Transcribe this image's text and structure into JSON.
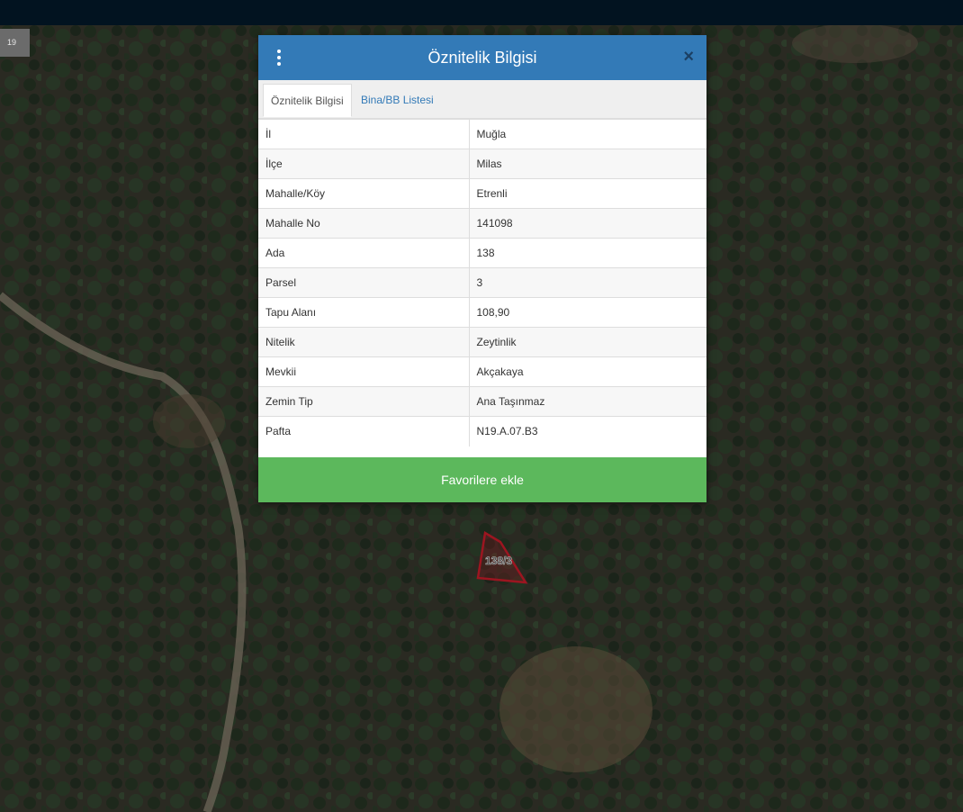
{
  "map": {
    "zoom_level": "19",
    "parcel_label": "138/3",
    "parcel_outline_color": "#9c1520"
  },
  "dialog": {
    "title": "Öznitelik Bilgisi",
    "close_symbol": "×",
    "menu_icon": "vertical-ellipsis",
    "tabs": [
      {
        "label": "Öznitelik Bilgisi",
        "active": true
      },
      {
        "label": "Bina/BB Listesi",
        "active": false
      }
    ],
    "rows": [
      {
        "key": "İl",
        "value": "Muğla"
      },
      {
        "key": "İlçe",
        "value": "Milas"
      },
      {
        "key": "Mahalle/Köy",
        "value": "Etrenli"
      },
      {
        "key": "Mahalle No",
        "value": "141098"
      },
      {
        "key": "Ada",
        "value": "138"
      },
      {
        "key": "Parsel",
        "value": "3"
      },
      {
        "key": "Tapu Alanı",
        "value": "108,90"
      },
      {
        "key": "Nitelik",
        "value": "Zeytinlik"
      },
      {
        "key": "Mevkii",
        "value": "Akçakaya"
      },
      {
        "key": "Zemin Tip",
        "value": "Ana Taşınmaz"
      },
      {
        "key": "Pafta",
        "value": "N19.A.07.B3"
      }
    ],
    "favorite_button_label": "Favorilere ekle"
  },
  "colors": {
    "header_blue": "#337ab7",
    "button_green": "#5cb85c",
    "topbar": "#021320"
  }
}
